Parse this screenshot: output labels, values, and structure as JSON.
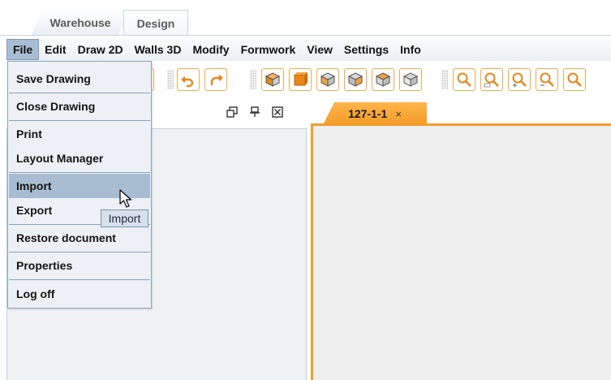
{
  "top_tabs": [
    {
      "label": "Warehouse"
    },
    {
      "label": "Design"
    }
  ],
  "menubar": {
    "items": [
      {
        "label": "File",
        "active": true
      },
      {
        "label": "Edit"
      },
      {
        "label": "Draw 2D"
      },
      {
        "label": "Walls 3D"
      },
      {
        "label": "Modify"
      },
      {
        "label": "Formwork"
      },
      {
        "label": "View"
      },
      {
        "label": "Settings"
      },
      {
        "label": "Info"
      }
    ]
  },
  "file_menu": {
    "items": [
      {
        "label": "Save Drawing"
      },
      {
        "label": "Close Drawing"
      },
      {
        "label": "Print"
      },
      {
        "label": "Layout Manager"
      },
      {
        "label": "Import",
        "hovered": true
      },
      {
        "label": "Export"
      },
      {
        "label": "Restore document"
      },
      {
        "label": "Properties"
      },
      {
        "label": "Log off"
      }
    ]
  },
  "tooltip": {
    "text": "Import"
  },
  "toolbar": {
    "buttons": [
      "undo-icon",
      "redo-icon",
      "cube-view-1-icon",
      "cube-solid-icon",
      "cube-view-2-icon",
      "cube-view-3-icon",
      "cube-view-4-icon",
      "cube-view-5-icon",
      "zoom-icon",
      "zoom-window-icon",
      "zoom-in-icon",
      "zoom-out-icon"
    ],
    "accent_color": "#f39c2a"
  },
  "left_panel": {
    "header_icons": [
      "restore-window-icon",
      "pin-icon",
      "close-box-icon"
    ]
  },
  "document": {
    "tab_label": "127-1-1",
    "close_glyph": "×",
    "tab_color": "#f39c2a"
  },
  "colors": {
    "menu_highlight": "#a9bdd2",
    "menu_border": "#8aa3bf",
    "tab_accent": "#f39c2a"
  }
}
